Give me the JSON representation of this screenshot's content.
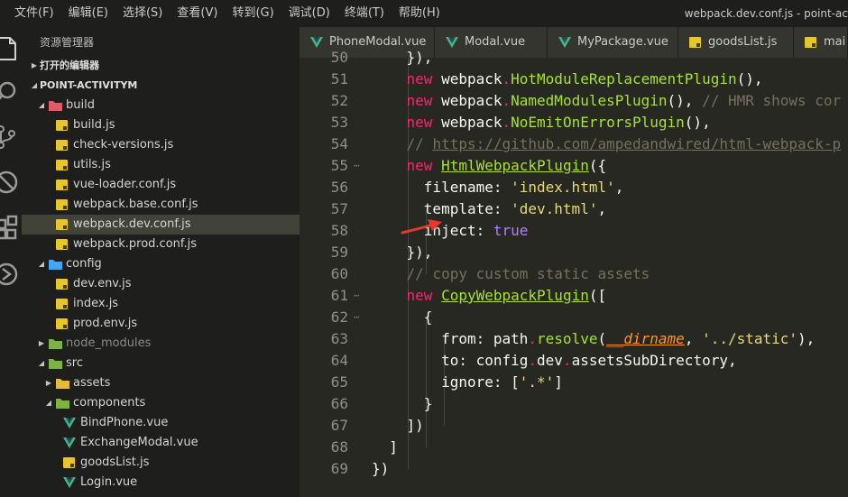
{
  "menu": [
    "文件(F)",
    "编辑(E)",
    "选择(S)",
    "查看(V)",
    "转到(G)",
    "调试(D)",
    "终端(T)",
    "帮助(H)"
  ],
  "window_title": "webpack.dev.conf.js - point-ac",
  "sidebar": {
    "title": "资源管理器",
    "open_editors": "打开的编辑器",
    "project": "POINT-ACTIVITYM",
    "items": [
      {
        "label": "build",
        "type": "folder-red",
        "depth": 1,
        "open": true
      },
      {
        "label": "build.js",
        "type": "js",
        "depth": 2
      },
      {
        "label": "check-versions.js",
        "type": "js",
        "depth": 2
      },
      {
        "label": "utils.js",
        "type": "js",
        "depth": 2
      },
      {
        "label": "vue-loader.conf.js",
        "type": "js",
        "depth": 2
      },
      {
        "label": "webpack.base.conf.js",
        "type": "js",
        "depth": 2
      },
      {
        "label": "webpack.dev.conf.js",
        "type": "js",
        "depth": 2,
        "selected": true
      },
      {
        "label": "webpack.prod.conf.js",
        "type": "js",
        "depth": 2
      },
      {
        "label": "config",
        "type": "folder-blue",
        "depth": 1,
        "open": true
      },
      {
        "label": "dev.env.js",
        "type": "js",
        "depth": 2
      },
      {
        "label": "index.js",
        "type": "js",
        "depth": 2
      },
      {
        "label": "prod.env.js",
        "type": "js",
        "depth": 2
      },
      {
        "label": "node_modules",
        "type": "folder-green",
        "depth": 1,
        "open": false,
        "dim": true
      },
      {
        "label": "src",
        "type": "folder-green",
        "depth": 1,
        "open": true
      },
      {
        "label": "assets",
        "type": "folder-yellow",
        "depth": 2,
        "open": false
      },
      {
        "label": "components",
        "type": "folder-green",
        "depth": 2,
        "open": true
      },
      {
        "label": "BindPhone.vue",
        "type": "vue",
        "depth": 3
      },
      {
        "label": "ExchangeModal.vue",
        "type": "vue",
        "depth": 3
      },
      {
        "label": "goodsList.js",
        "type": "js",
        "depth": 3
      },
      {
        "label": "Login.vue",
        "type": "vue",
        "depth": 3
      }
    ]
  },
  "tabs": [
    {
      "label": "PhoneModal.vue",
      "type": "vue"
    },
    {
      "label": "Modal.vue",
      "type": "vue"
    },
    {
      "label": "MyPackage.vue",
      "type": "vue"
    },
    {
      "label": "goodsList.js",
      "type": "js"
    },
    {
      "label": "mai",
      "type": "js"
    }
  ],
  "code_lines": [
    {
      "n": "50",
      "fold": "",
      "t": [
        [
          "    }),",
          "prop"
        ]
      ]
    },
    {
      "n": "51",
      "fold": "",
      "t": [
        [
          "    ",
          "prop"
        ],
        [
          "new",
          "kw"
        ],
        [
          " webpack",
          "prop"
        ],
        [
          ".",
          "kw"
        ],
        [
          "HotModuleReplacementPlugin",
          "fn"
        ],
        [
          "(),",
          "prop"
        ]
      ]
    },
    {
      "n": "52",
      "fold": "",
      "t": [
        [
          "    ",
          "prop"
        ],
        [
          "new",
          "kw"
        ],
        [
          " webpack",
          "prop"
        ],
        [
          ".",
          "kw"
        ],
        [
          "NamedModulesPlugin",
          "fn"
        ],
        [
          "(), ",
          "prop"
        ],
        [
          "// HMR shows cor",
          "cmt"
        ]
      ]
    },
    {
      "n": "53",
      "fold": "",
      "t": [
        [
          "    ",
          "prop"
        ],
        [
          "new",
          "kw"
        ],
        [
          " webpack",
          "prop"
        ],
        [
          ".",
          "kw"
        ],
        [
          "NoEmitOnErrorsPlugin",
          "fn"
        ],
        [
          "(),",
          "prop"
        ]
      ]
    },
    {
      "n": "54",
      "fold": "",
      "t": [
        [
          "    // ",
          "cmt"
        ],
        [
          "https://github.com/ampedandwired/html-webpack-p",
          "cmt-u"
        ]
      ]
    },
    {
      "n": "55",
      "fold": "⋯",
      "t": [
        [
          "    ",
          "prop"
        ],
        [
          "new",
          "kw"
        ],
        [
          " ",
          "prop"
        ],
        [
          "HtmlWebpackPlugin",
          "cls"
        ],
        [
          "({",
          "prop"
        ]
      ]
    },
    {
      "n": "56",
      "fold": "",
      "t": [
        [
          "      filename: ",
          "prop"
        ],
        [
          "'index.html'",
          "str"
        ],
        [
          ",",
          "prop"
        ]
      ]
    },
    {
      "n": "57",
      "fold": "",
      "t": [
        [
          "      template: ",
          "prop"
        ],
        [
          "'dev.html'",
          "str"
        ],
        [
          ",",
          "prop"
        ]
      ]
    },
    {
      "n": "58",
      "fold": "",
      "t": [
        [
          "      inject: ",
          "prop"
        ],
        [
          "true",
          "cst"
        ]
      ]
    },
    {
      "n": "59",
      "fold": "",
      "t": [
        [
          "    }),",
          "prop"
        ]
      ]
    },
    {
      "n": "60",
      "fold": "",
      "t": [
        [
          "    // copy custom static assets",
          "cmt"
        ]
      ]
    },
    {
      "n": "61",
      "fold": "⋯",
      "t": [
        [
          "    ",
          "prop"
        ],
        [
          "new",
          "kw"
        ],
        [
          " ",
          "prop"
        ],
        [
          "CopyWebpackPlugin",
          "cls"
        ],
        [
          "([",
          "prop"
        ]
      ]
    },
    {
      "n": "62",
      "fold": "⋯",
      "t": [
        [
          "      {",
          "prop"
        ]
      ]
    },
    {
      "n": "63",
      "fold": "",
      "t": [
        [
          "        from: path",
          "prop"
        ],
        [
          ".",
          "kw"
        ],
        [
          "resolve",
          "fn"
        ],
        [
          "(",
          "prop"
        ],
        [
          "__dirname",
          "arg"
        ],
        [
          ", ",
          "prop"
        ],
        [
          "'../static'",
          "str"
        ],
        [
          "),",
          "prop"
        ]
      ]
    },
    {
      "n": "64",
      "fold": "",
      "t": [
        [
          "        to: config",
          "prop"
        ],
        [
          ".",
          "kw"
        ],
        [
          "dev",
          "prop"
        ],
        [
          ".",
          "kw"
        ],
        [
          "assetsSubDirectory,",
          "prop"
        ]
      ]
    },
    {
      "n": "65",
      "fold": "",
      "t": [
        [
          "        ignore: [",
          "prop"
        ],
        [
          "'.*'",
          "str"
        ],
        [
          "]",
          "prop"
        ]
      ]
    },
    {
      "n": "66",
      "fold": "",
      "t": [
        [
          "      }",
          "prop"
        ]
      ]
    },
    {
      "n": "67",
      "fold": "",
      "t": [
        [
          "    ])",
          "prop"
        ]
      ]
    },
    {
      "n": "68",
      "fold": "",
      "t": [
        [
          "  ]",
          "prop"
        ]
      ]
    },
    {
      "n": "69",
      "fold": "",
      "t": [
        [
          "})",
          "prop"
        ]
      ]
    }
  ],
  "colors": {
    "accent": "#f92672",
    "arrow": "#e53a2a",
    "selection": "#414339"
  }
}
